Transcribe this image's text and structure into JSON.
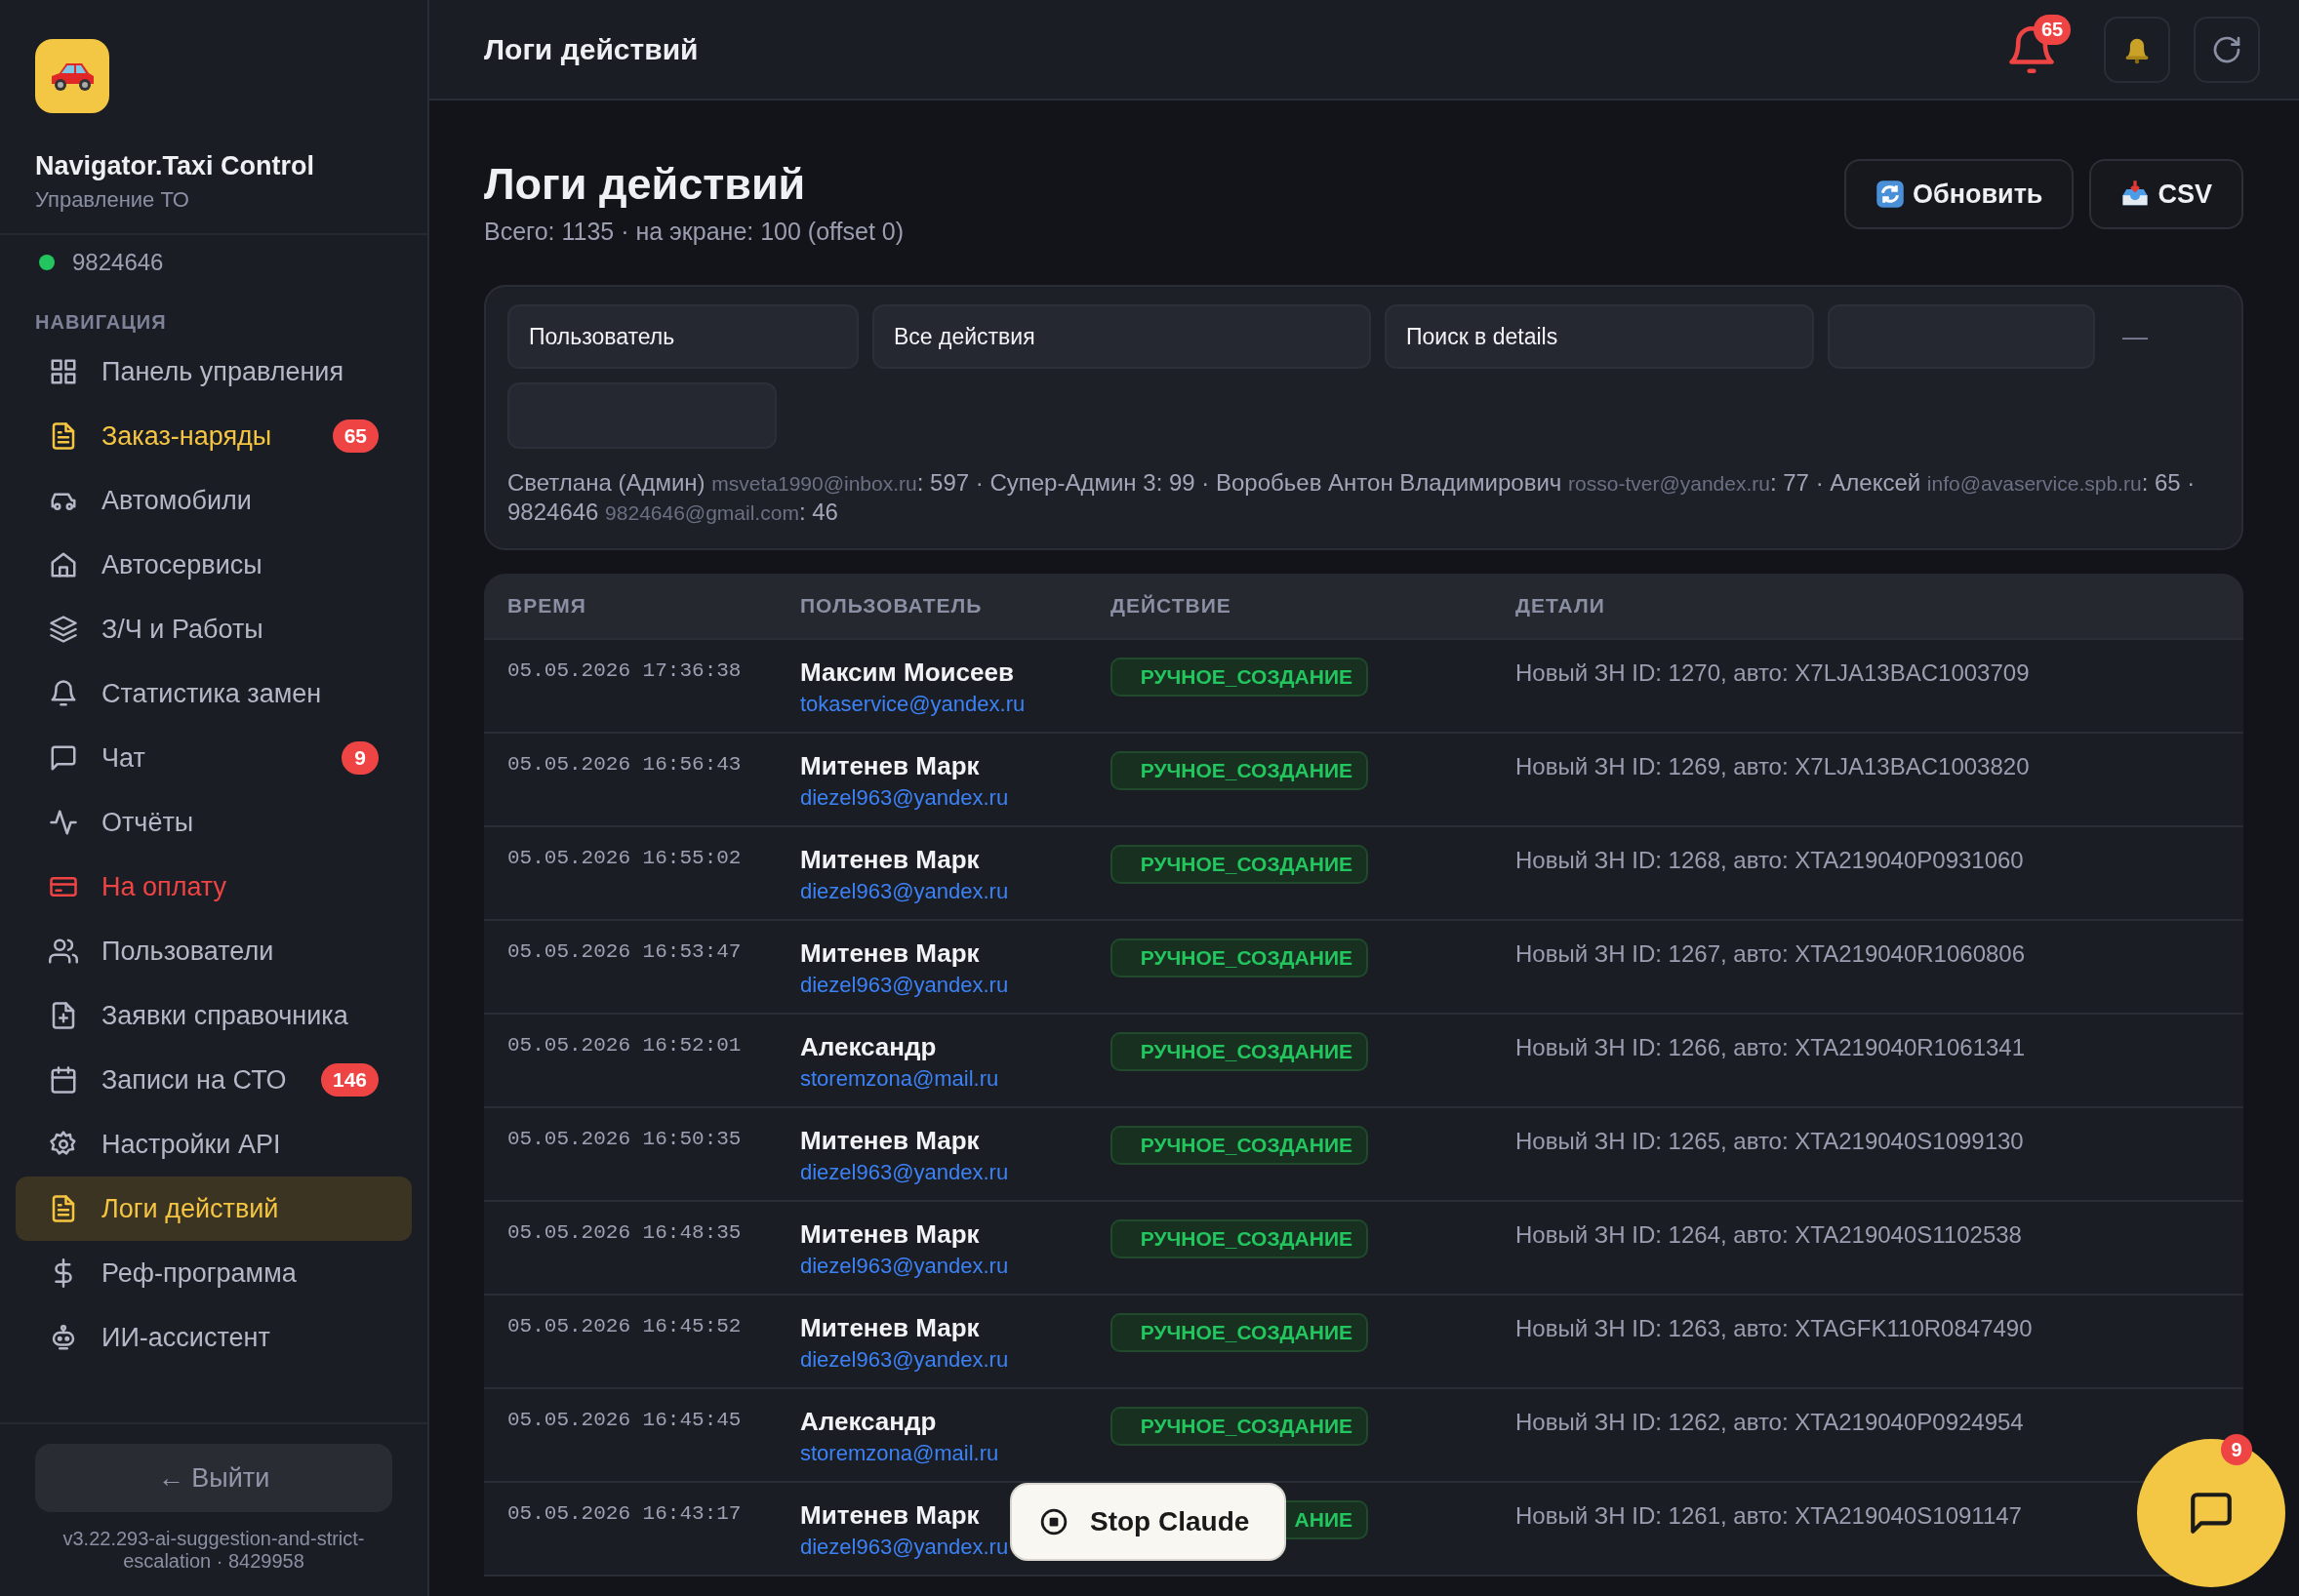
{
  "app": {
    "name": "Navigator.Taxi Control",
    "subtitle": "Управление ТО"
  },
  "status": {
    "label": "9824646",
    "online": true
  },
  "sidebar": {
    "heading": "НАВИГАЦИЯ",
    "items": [
      {
        "label": "Панель управления",
        "highlighted": false,
        "alert": false,
        "selected": false
      },
      {
        "label": "Заказ-наряды",
        "highlighted": true,
        "alert": false,
        "badge": "65",
        "selected": false
      },
      {
        "label": "Автомобили",
        "highlighted": false,
        "alert": false,
        "selected": false
      },
      {
        "label": "Автосервисы",
        "highlighted": false,
        "alert": false,
        "selected": false
      },
      {
        "label": "З/Ч и Работы",
        "highlighted": false,
        "alert": false,
        "selected": false
      },
      {
        "label": "Статистика замен",
        "highlighted": false,
        "alert": false,
        "selected": false
      },
      {
        "label": "Чат",
        "highlighted": false,
        "alert": false,
        "badge": "9",
        "selected": false
      },
      {
        "label": "Отчёты",
        "highlighted": false,
        "alert": false,
        "selected": false
      },
      {
        "label": "На оплату",
        "highlighted": false,
        "alert": true,
        "selected": false
      },
      {
        "label": "Пользователи",
        "highlighted": false,
        "alert": false,
        "selected": false
      },
      {
        "label": "Заявки справочника",
        "highlighted": false,
        "alert": false,
        "selected": false
      },
      {
        "label": "Записи на СТО",
        "highlighted": false,
        "alert": false,
        "badge": "146",
        "selected": false
      },
      {
        "label": "Настройки API",
        "highlighted": false,
        "alert": false,
        "selected": false
      },
      {
        "label": "Логи действий",
        "highlighted": false,
        "alert": false,
        "selected": true
      },
      {
        "label": "Реф-программа",
        "highlighted": false,
        "alert": false,
        "selected": false
      },
      {
        "label": "ИИ-ассистент",
        "highlighted": false,
        "alert": false,
        "selected": false
      }
    ],
    "logout": "← Выйти",
    "version": "v3.22.293-ai-suggestion-and-strict-escalation · 8429958"
  },
  "topbar": {
    "title": "Логи действий",
    "alert_badge": "65"
  },
  "page": {
    "title": "Логи действий",
    "summary": "Всего: 1135 · на экране: 100 (offset 0)",
    "buttons": [
      "Обновить",
      "CSV"
    ]
  },
  "filters": {
    "fields": [
      {
        "kind": "select",
        "value": "Пользователь"
      },
      {
        "kind": "select",
        "value": "Все действия"
      },
      {
        "kind": "search",
        "placeholder": "Поиск в details"
      }
    ],
    "range_separator": "—",
    "separator": " · ",
    "stats": [
      {
        "name": "Светлана (Админ)",
        "email": "msveta1990@inbox.ru",
        "suffix": ": 597"
      },
      {
        "name": "Супер-Админ 3",
        "suffix": ": 99"
      },
      {
        "name": "Воробьев Антон Владимирович",
        "email": "rosso-tver@yandex.ru",
        "suffix": ": 77"
      },
      {
        "name": "Алексей",
        "email": "info@avaservice.spb.ru",
        "suffix": ": 65"
      },
      {
        "name": "9824646",
        "email": "9824646@gmail.com",
        "suffix": ": 46"
      }
    ]
  },
  "table": {
    "columns": [
      "ВРЕМЯ",
      "ПОЛЬЗОВАТЕЛЬ",
      "ДЕЙСТВИЕ",
      "ДЕТАЛИ"
    ],
    "rows": [
      {
        "time": "05.05.2026 17:36:38",
        "user": "Максим Моисеев",
        "email": "tokaservice@yandex.ru",
        "action": "РУЧНОЕ_СОЗДАНИЕ",
        "details": "Новый ЗН ID: 1270, авто: X7LJA13BAC1003709"
      },
      {
        "time": "05.05.2026 16:56:43",
        "user": "Митенев Марк",
        "email": "diezel963@yandex.ru",
        "action": "РУЧНОЕ_СОЗДАНИЕ",
        "details": "Новый ЗН ID: 1269, авто: X7LJA13BAC1003820"
      },
      {
        "time": "05.05.2026 16:55:02",
        "user": "Митенев Марк",
        "email": "diezel963@yandex.ru",
        "action": "РУЧНОЕ_СОЗДАНИЕ",
        "details": "Новый ЗН ID: 1268, авто: XTA219040P0931060"
      },
      {
        "time": "05.05.2026 16:53:47",
        "user": "Митенев Марк",
        "email": "diezel963@yandex.ru",
        "action": "РУЧНОЕ_СОЗДАНИЕ",
        "details": "Новый ЗН ID: 1267, авто: XTA219040R1060806"
      },
      {
        "time": "05.05.2026 16:52:01",
        "user": "Александр",
        "email": "storemzona@mail.ru",
        "action": "РУЧНОЕ_СОЗДАНИЕ",
        "details": "Новый ЗН ID: 1266, авто: XTA219040R1061341"
      },
      {
        "time": "05.05.2026 16:50:35",
        "user": "Митенев Марк",
        "email": "diezel963@yandex.ru",
        "action": "РУЧНОЕ_СОЗДАНИЕ",
        "details": "Новый ЗН ID: 1265, авто: XTA219040S1099130"
      },
      {
        "time": "05.05.2026 16:48:35",
        "user": "Митенев Марк",
        "email": "diezel963@yandex.ru",
        "action": "РУЧНОЕ_СОЗДАНИЕ",
        "details": "Новый ЗН ID: 1264, авто: XTA219040S1102538"
      },
      {
        "time": "05.05.2026 16:45:52",
        "user": "Митенев Марк",
        "email": "diezel963@yandex.ru",
        "action": "РУЧНОЕ_СОЗДАНИЕ",
        "details": "Новый ЗН ID: 1263, авто: XTAGFK110R0847490"
      },
      {
        "time": "05.05.2026 16:45:45",
        "user": "Александр",
        "email": "storemzona@mail.ru",
        "action": "РУЧНОЕ_СОЗДАНИЕ",
        "details": "Новый ЗН ID: 1262, авто: XTA219040P0924954"
      },
      {
        "time": "05.05.2026 16:43:17",
        "user": "Митенев Марк",
        "email": "diezel963@yandex.ru",
        "action": "АНИЕ",
        "details": "Новый ЗН ID: 1261, авто: XTA219040S1091147"
      }
    ]
  },
  "overlay": {
    "stop_label": "Stop Claude"
  },
  "chat": {
    "badge": "9"
  }
}
